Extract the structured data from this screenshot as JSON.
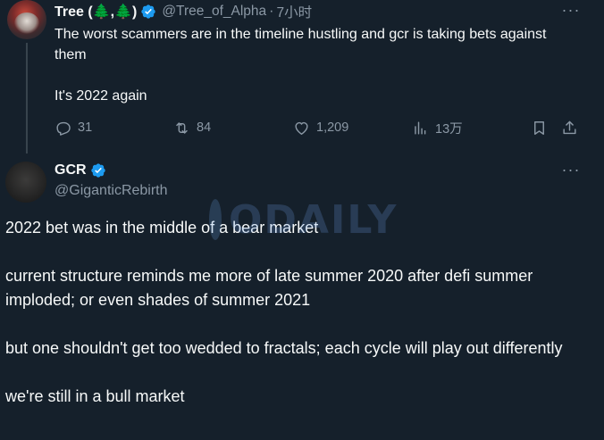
{
  "tweet1": {
    "display_name": "Tree (🌲,🌲)",
    "handle": "@Tree_of_Alpha",
    "separator": "·",
    "time": "7小时",
    "more_label": "···",
    "text_lines": [
      "The worst scammers are in the timeline hustling and gcr is taking bets against them",
      "It's 2022 again"
    ],
    "actions": {
      "replies": "31",
      "reposts": "84",
      "likes": "1,209",
      "views": "13万"
    }
  },
  "tweet2": {
    "display_name": "GCR",
    "handle": "@GiganticRebirth",
    "more_label": "···",
    "paragraphs": [
      "2022 bet was in the middle of a bear market",
      "current structure reminds me more of late summer 2020 after defi summer imploded;  or even shades of summer 2021",
      "but one shouldn't get too wedded to fractals;  each cycle will play out differently",
      "we're still in a bull market"
    ]
  },
  "watermark": {
    "text": "ODAILY"
  },
  "colors": {
    "background": "#15202b",
    "text": "#f7f9f9",
    "muted": "#8b98a5",
    "verified": "#1d9bf0"
  },
  "icons": [
    "reply-icon",
    "repost-icon",
    "like-icon",
    "views-icon",
    "bookmark-icon",
    "share-icon",
    "verified-badge-icon",
    "more-icon"
  ]
}
